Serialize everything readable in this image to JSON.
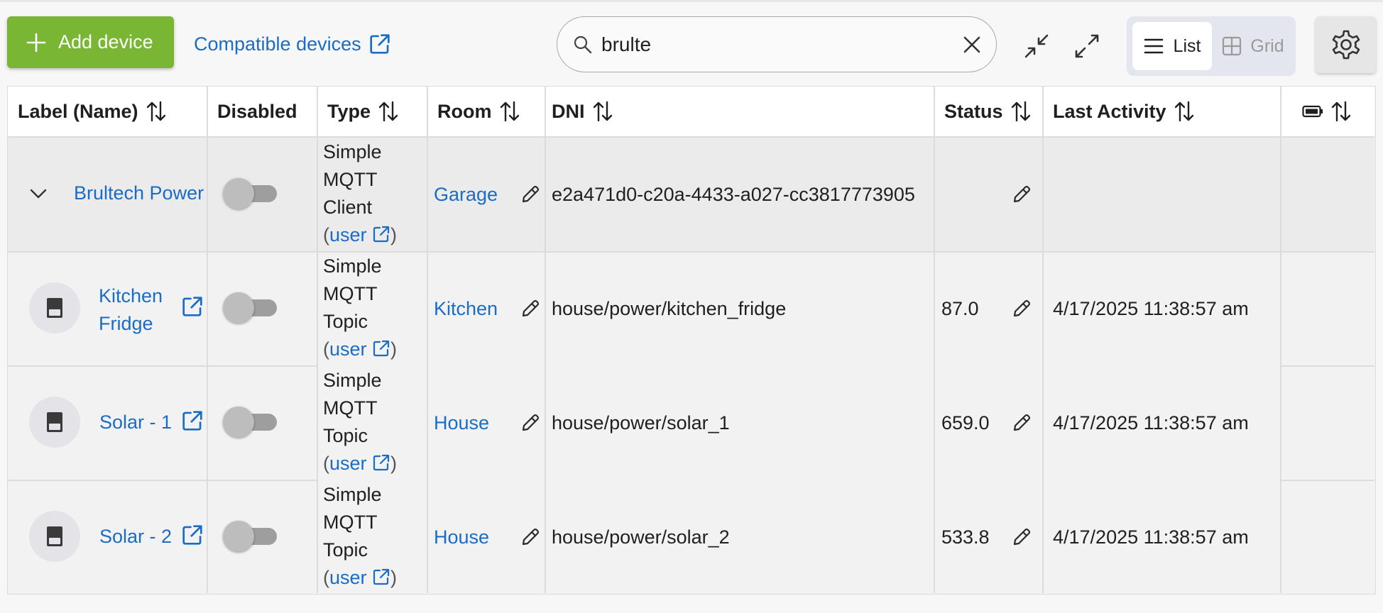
{
  "toolbar": {
    "add_device_label": "Add device",
    "compatible_devices_label": "Compatible devices",
    "search_value": "brulte",
    "view_list_label": "List",
    "view_grid_label": "Grid"
  },
  "table": {
    "headers": {
      "label": "Label (Name)",
      "disabled": "Disabled",
      "type": "Type",
      "room": "Room",
      "dni": "DNI",
      "status": "Status",
      "last_activity": "Last Activity",
      "battery_icon": "battery-icon"
    },
    "rows": [
      {
        "label": "Brultech Power",
        "type_line1": "Simple",
        "type_line2": "MQTT",
        "type_line3": "Client",
        "type_link": "user",
        "room": "Garage",
        "dni": "e2a471d0-c20a-4433-a027-cc3817773905",
        "status": "",
        "last_activity": ""
      },
      {
        "label_line1": "Kitchen",
        "label_line2": "Fridge",
        "type_line1": "Simple",
        "type_line2": "MQTT",
        "type_line3": "Topic",
        "type_link": "user",
        "room": "Kitchen",
        "dni": "house/power/kitchen_fridge",
        "status": "87.0",
        "last_activity": "4/17/2025 11:38:57 am"
      },
      {
        "label": "Solar - 1",
        "type_line1": "Simple",
        "type_line2": "MQTT",
        "type_line3": "Topic",
        "type_link": "user",
        "room": "House",
        "dni": "house/power/solar_1",
        "status": "659.0",
        "last_activity": "4/17/2025 11:38:57 am"
      },
      {
        "label": "Solar - 2",
        "type_line1": "Simple",
        "type_line2": "MQTT",
        "type_line3": "Topic",
        "type_link": "user",
        "room": "House",
        "dni": "house/power/solar_2",
        "status": "533.8",
        "last_activity": "4/17/2025 11:38:57 am"
      }
    ]
  },
  "colors": {
    "accent_green": "#79b633",
    "link_blue": "#1a6cc4",
    "parent_row_bg": "#ebebeb",
    "child_row_bg": "#f2f2f2"
  }
}
